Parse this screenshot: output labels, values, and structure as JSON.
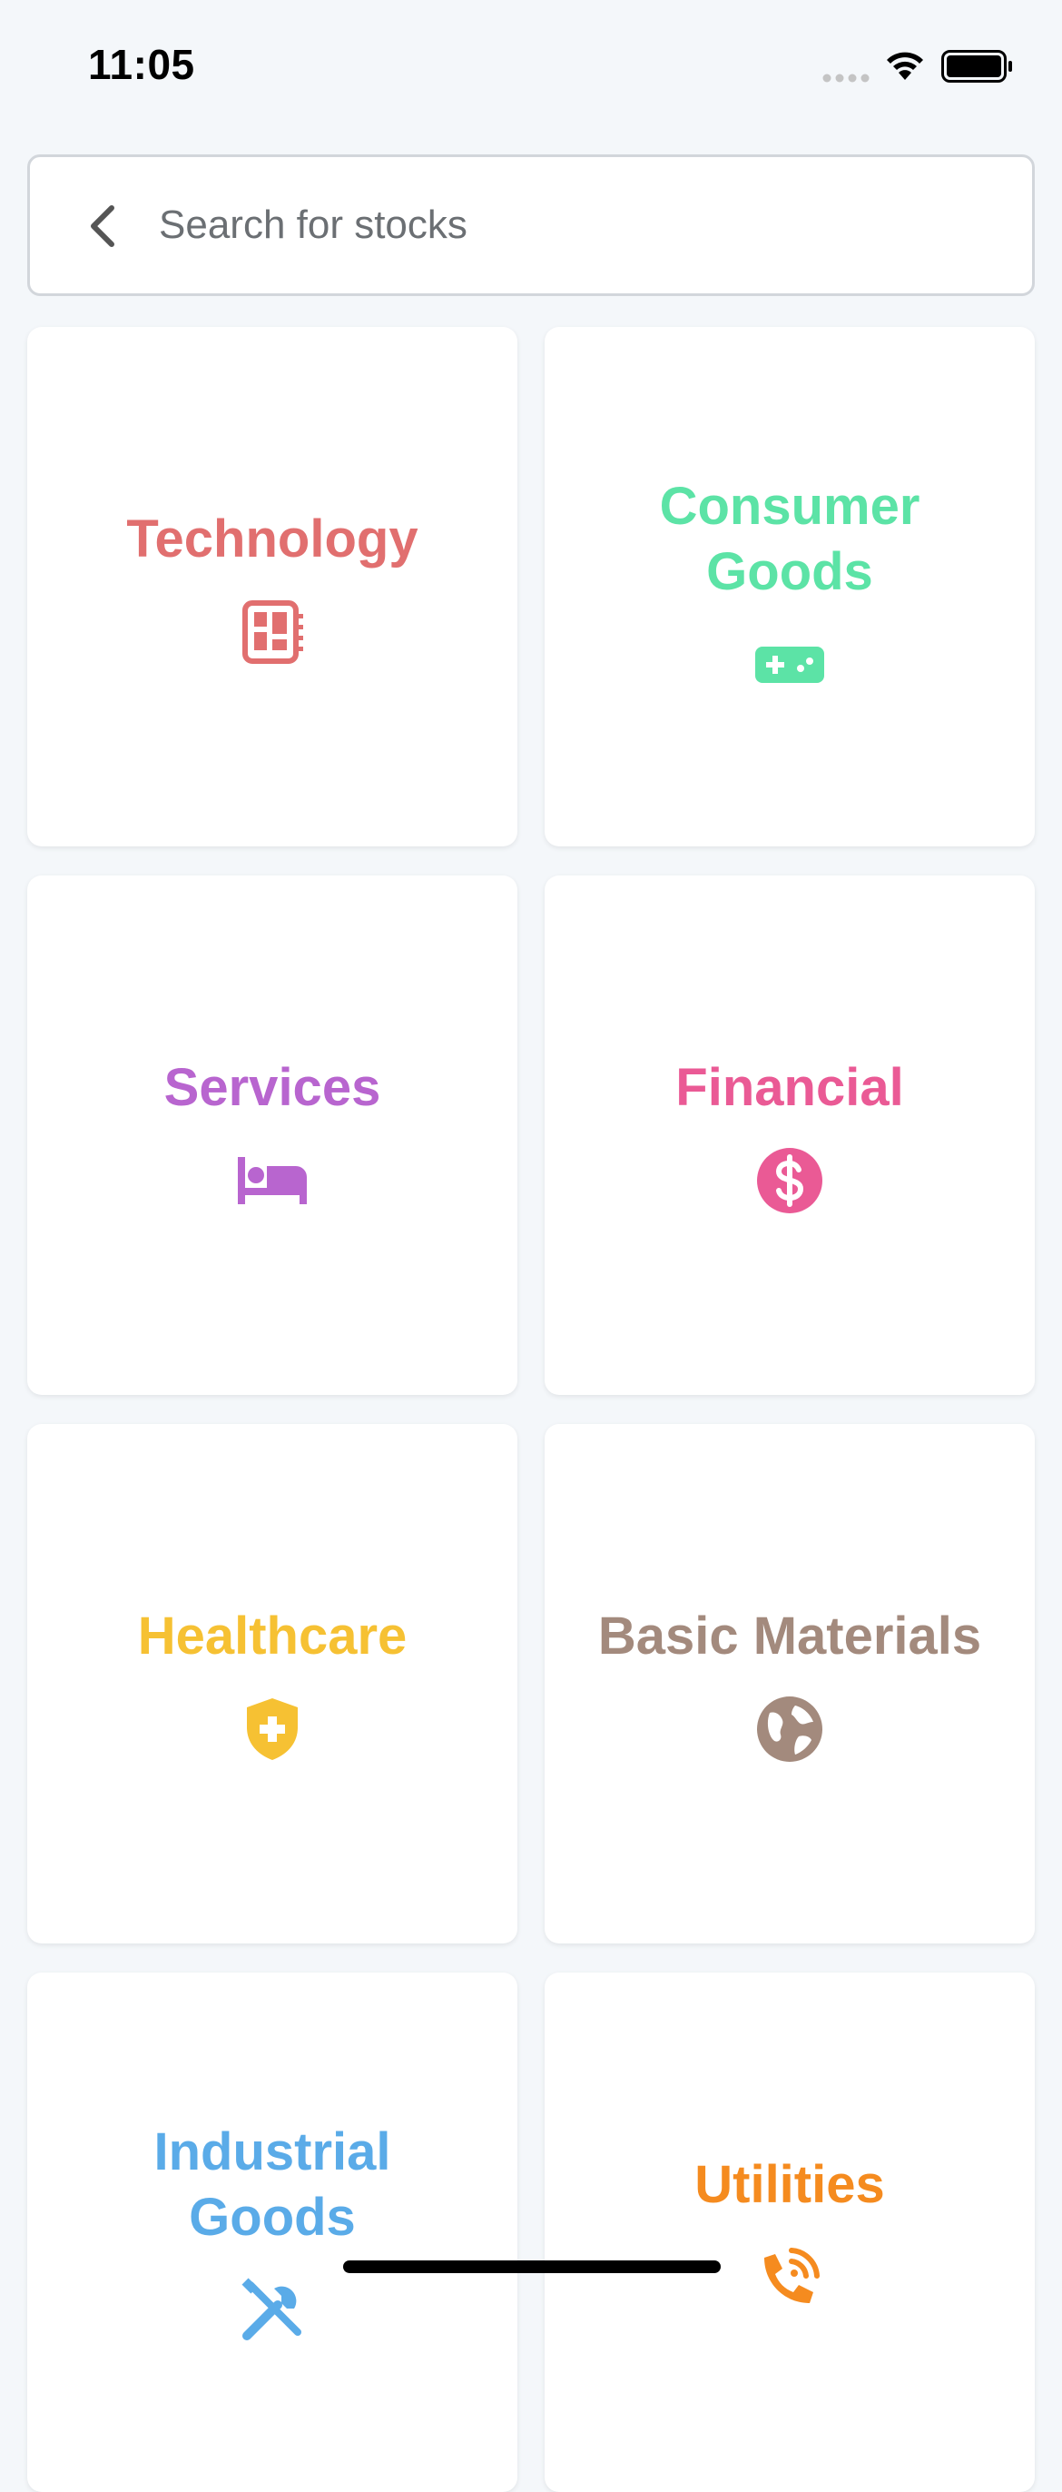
{
  "status": {
    "time": "11:05"
  },
  "search": {
    "placeholder": "Search for stocks",
    "value": ""
  },
  "categories": [
    {
      "label": "Technology",
      "icon": "circuit-board-icon",
      "color": "#e16f6f"
    },
    {
      "label": "Consumer Goods",
      "icon": "gamepad-icon",
      "color": "#5ce3a6"
    },
    {
      "label": "Services",
      "icon": "bed-icon",
      "color": "#b865cf"
    },
    {
      "label": "Financial",
      "icon": "dollar-circle-icon",
      "color": "#ea5a95"
    },
    {
      "label": "Healthcare",
      "icon": "shield-plus-icon",
      "color": "#f6c133"
    },
    {
      "label": "Basic Materials",
      "icon": "globe-icon",
      "color": "#a38a7d"
    },
    {
      "label": "Industrial Goods",
      "icon": "tools-icon",
      "color": "#5aabe8"
    },
    {
      "label": "Utilities",
      "icon": "phone-wifi-icon",
      "color": "#f58b1f"
    }
  ]
}
